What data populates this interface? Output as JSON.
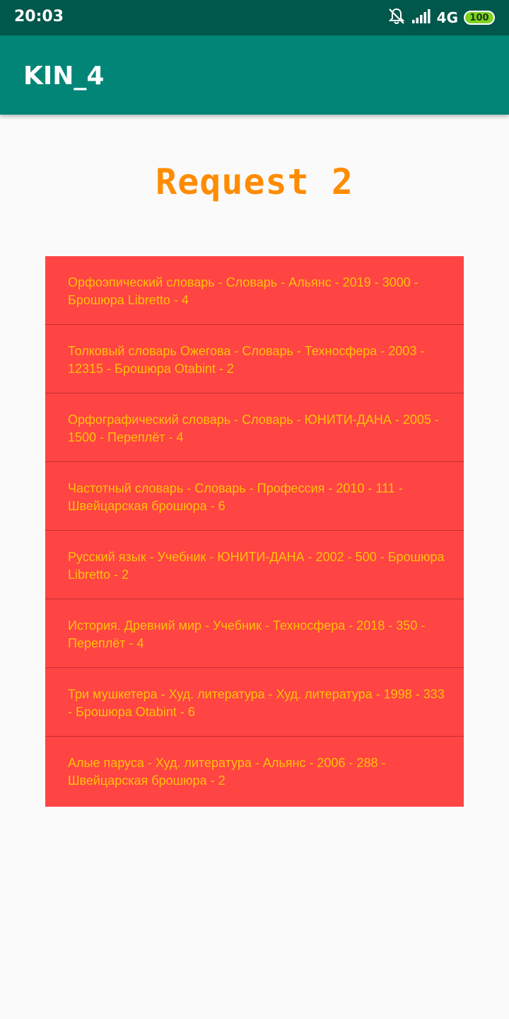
{
  "status_bar": {
    "time": "20:03",
    "network": "4G",
    "battery": "100",
    "icons": [
      "notifications-off-icon",
      "signal-icon",
      "battery-icon"
    ]
  },
  "app_bar": {
    "title": "KIN_4"
  },
  "heading": "Request 2",
  "colors": {
    "status_bar": "#00574b",
    "app_bar": "#008577",
    "heading": "#ff8c00",
    "list_background": "#ff4444",
    "list_text": "#ffc107",
    "page_background": "#fafafa"
  },
  "items": [
    {
      "text": "Орфоэпический словарь - Словарь - Альянс - 2019 - 3000 - Брошюра Libretto - 4"
    },
    {
      "text": "Толковый словарь Ожегова - Словарь - Техносфера - 2003 - 12315 - Брошюра Otabint - 2"
    },
    {
      "text": "Орфографический словарь - Словарь - ЮНИТИ-ДАНА - 2005 - 1500 - Переплёт - 4"
    },
    {
      "text": "Частотный словарь - Словарь - Профессия - 2010 - 111 - Швейцарская брошюра - 6"
    },
    {
      "text": "Русский язык - Учебник - ЮНИТИ-ДАНА - 2002 - 500 - Брошюра Libretto - 2"
    },
    {
      "text": "История. Древний мир - Учебник - Техносфера - 2018 - 350 - Переплёт - 4"
    },
    {
      "text": "Три мушкетера - Худ. литература - Худ. литература - 1998 - 333 - Брошюра Otabint - 6"
    },
    {
      "text": "Алые паруса - Худ. литература - Альянс - 2006 - 288 - Швейцарская брошюра - 2"
    }
  ]
}
